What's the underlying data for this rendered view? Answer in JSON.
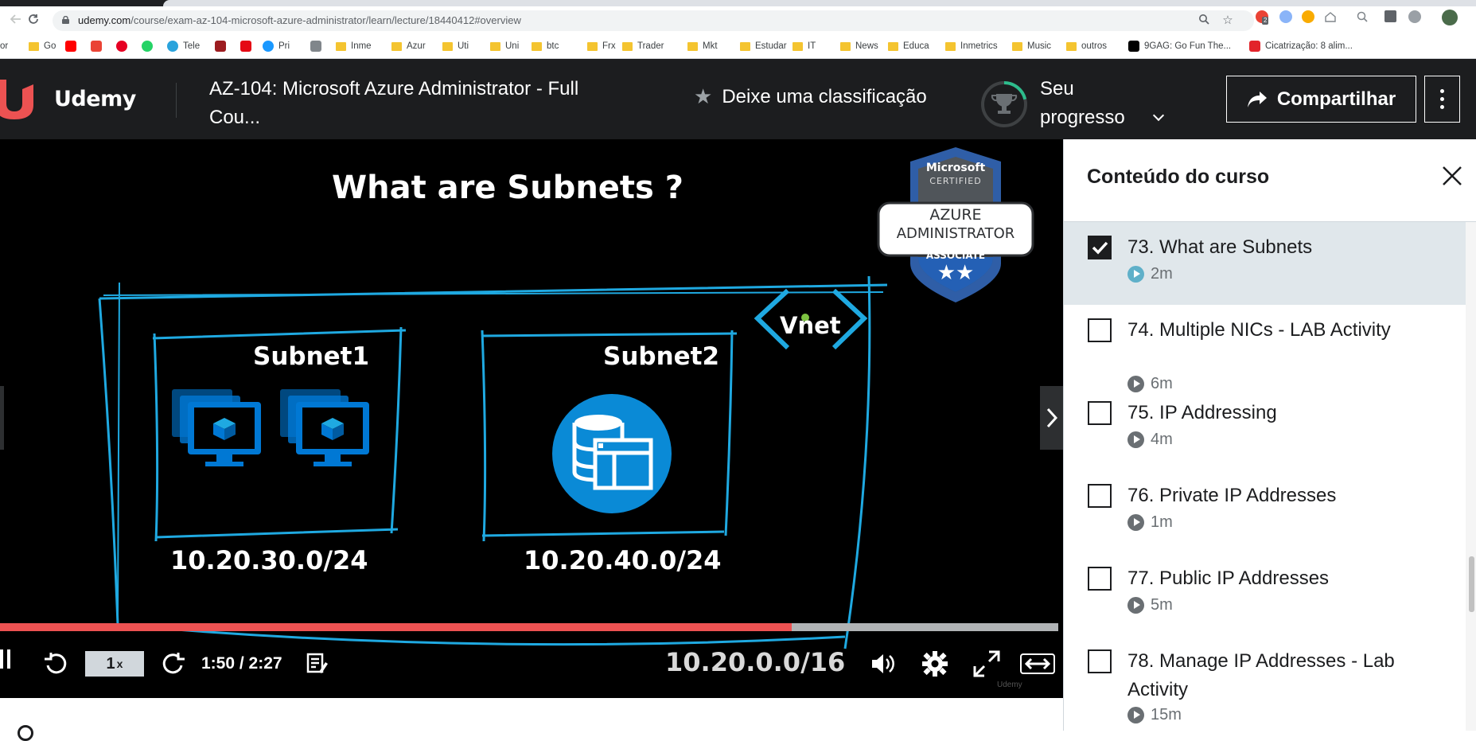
{
  "browser": {
    "url_host": "udemy.com",
    "url_path": "/course/exam-az-104-microsoft-azure-administrator/learn/lecture/18440412#overview",
    "left_edge_text": "or",
    "bookmarks": [
      {
        "label": "Go",
        "kind": "folder"
      },
      {
        "label": "",
        "kind": "youtube"
      },
      {
        "label": "",
        "kind": "gmail"
      },
      {
        "label": "",
        "kind": "pinterest"
      },
      {
        "label": "",
        "kind": "whatsapp"
      },
      {
        "label": "Tele",
        "kind": "telegram"
      },
      {
        "label": "",
        "kind": "fx"
      },
      {
        "label": "",
        "kind": "netflix"
      },
      {
        "label": "Pri",
        "kind": "prime"
      },
      {
        "label": "",
        "kind": "download"
      },
      {
        "label": "Inme",
        "kind": "folder"
      },
      {
        "label": "Azur",
        "kind": "folder"
      },
      {
        "label": "Uti",
        "kind": "folder"
      },
      {
        "label": "Uni",
        "kind": "folder"
      },
      {
        "label": "btc",
        "kind": "folder"
      },
      {
        "label": "Frx",
        "kind": "folder"
      },
      {
        "label": "Trader",
        "kind": "folder"
      },
      {
        "label": "Mkt",
        "kind": "folder"
      },
      {
        "label": "Estudar",
        "kind": "folder"
      },
      {
        "label": "IT",
        "kind": "folder"
      },
      {
        "label": "News",
        "kind": "folder"
      },
      {
        "label": "Educa",
        "kind": "folder"
      },
      {
        "label": "Inmetrics",
        "kind": "folder"
      },
      {
        "label": "Music",
        "kind": "folder"
      },
      {
        "label": "outros",
        "kind": "folder"
      },
      {
        "label": "9GAG: Go Fun The...",
        "kind": "9gag"
      },
      {
        "label": "Cicatrização: 8 alim...",
        "kind": "site-s"
      }
    ],
    "extension_badge": "2"
  },
  "header": {
    "logo_text": "Udemy",
    "course_title": "AZ-104: Microsoft Azure Administrator - Full Cou...",
    "rate_label": "Deixe uma classificação",
    "progress_label": "Seu progresso",
    "share_label": "Compartilhar"
  },
  "video": {
    "slide_title": "What are Subnets ?",
    "subnet1_label": "Subnet1",
    "subnet2_label": "Subnet2",
    "subnet1_cidr": "10.20.30.0/24",
    "subnet2_cidr": "10.20.40.0/24",
    "vnet_label": "Vnet",
    "vnet_cidr": "10.20.0.0/16",
    "badge": {
      "line1": "Microsoft",
      "line2": "CERTIFIED",
      "line3": "AZURE",
      "line4": "ADMINISTRATOR",
      "line5": "ASSOCIATE",
      "stars": "★★"
    },
    "speed_value": "1",
    "speed_unit": "x",
    "time_display": "1:50 / 2:27",
    "progress_fraction": 0.748,
    "watermark": "Udemy"
  },
  "sidebar": {
    "title": "Conteúdo do curso",
    "lessons": [
      {
        "title": "73. What are Subnets",
        "duration": "2m",
        "checked": true,
        "active": true
      },
      {
        "title": "74. Multiple NICs - LAB Activity",
        "duration": "6m",
        "checked": false,
        "active": false
      },
      {
        "title": "75. IP Addressing",
        "duration": "4m",
        "checked": false,
        "active": false
      },
      {
        "title": "76. Private IP Addresses",
        "duration": "1m",
        "checked": false,
        "active": false
      },
      {
        "title": "77. Public IP Addresses",
        "duration": "5m",
        "checked": false,
        "active": false
      },
      {
        "title": "78. Manage IP Addresses - Lab Activity",
        "duration": "15m",
        "checked": false,
        "active": false
      }
    ]
  },
  "colors": {
    "udemy_dark": "#1c1d1f",
    "accent_red": "#ec5252",
    "slide_blue": "#1fa9e1",
    "icon_blue": "#0078d4",
    "progress_green": "#2dbc8c"
  }
}
